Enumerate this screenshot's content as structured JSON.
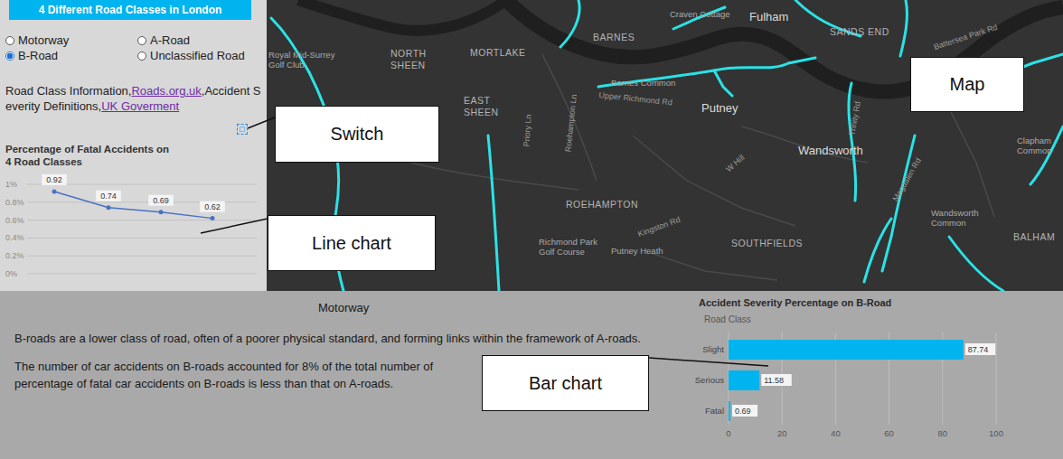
{
  "panel": {
    "title": "4 Different Road Classes in London",
    "road_classes": [
      {
        "label": "Motorway",
        "selected": false
      },
      {
        "label": "A-Road",
        "selected": false
      },
      {
        "label": "B-Road",
        "selected": true
      },
      {
        "label": "Unclassified Road",
        "selected": false
      }
    ],
    "sources": [
      {
        "text": "Road Class Information,",
        "kind": "text"
      },
      {
        "text": "Roads.org.uk",
        "kind": "link"
      },
      {
        "text": ",Accident Severity Definitions,",
        "kind": "text"
      },
      {
        "text": "UK Goverment",
        "kind": "link"
      }
    ],
    "line_chart": {
      "title": "Percentage of Fatal Accidents on 4 Road Classes",
      "ticks": [
        "1%",
        "0.8%",
        "0.6%",
        "0.4%",
        "0.2%",
        "0%"
      ],
      "values": [
        0.92,
        0.74,
        0.69,
        0.62
      ],
      "labels": [
        "0.92",
        "0.74",
        "0.69",
        "0.62"
      ]
    }
  },
  "description": {
    "heading": "Motorway",
    "paragraphs": [
      {
        "lines": [
          "B-roads are a lower class of road, often of a poorer physical standard, and forming links within the framework of A-roads."
        ]
      },
      {
        "lines": [
          "The number of car accidents on B-roads accounted for 8% of the total number of",
          "percentage of fatal car accidents on B-roads is less than that on A-roads."
        ]
      }
    ]
  },
  "bar_chart": {
    "title": "Accident Severity Percentage on B-Road",
    "axis_label": "Road Class",
    "ticks": [
      "0",
      "20",
      "40",
      "60",
      "80",
      "100"
    ],
    "bars": [
      {
        "label": "Slight",
        "value": 87.74,
        "reading": "87.74"
      },
      {
        "label": "Serious",
        "value": 11.58,
        "reading": "11.58"
      },
      {
        "label": "Fatal",
        "value": 0.69,
        "reading": "0.69"
      }
    ]
  },
  "map": {
    "labels": [
      {
        "text": "Craven Cottage",
        "kind": "poi"
      },
      {
        "text": "Fulham",
        "kind": "town"
      },
      {
        "text": "SANDS END",
        "kind": "area"
      },
      {
        "text": "Battersea Park Rd",
        "kind": "road"
      },
      {
        "text": "Royal Mid-Surrey Golf Club",
        "kind": "poi"
      },
      {
        "text": "NORTH SHEEN",
        "kind": "area"
      },
      {
        "text": "MORTLAKE",
        "kind": "area"
      },
      {
        "text": "BARNES",
        "kind": "area"
      },
      {
        "text": "Barnes Common",
        "kind": "poi"
      },
      {
        "text": "Upper Richmond Rd",
        "kind": "road"
      },
      {
        "text": "EAST SHEEN",
        "kind": "area"
      },
      {
        "text": "Putney",
        "kind": "town"
      },
      {
        "text": "Priory Ln",
        "kind": "road"
      },
      {
        "text": "Roehampton Ln",
        "kind": "road"
      },
      {
        "text": "Wandsworth",
        "kind": "town"
      },
      {
        "text": "W Hill",
        "kind": "road"
      },
      {
        "text": "Trinity Rd",
        "kind": "road"
      },
      {
        "text": "Clapham Common",
        "kind": "poi"
      },
      {
        "text": "ROEHAMPTON",
        "kind": "area"
      },
      {
        "text": "Richmond Park Golf Course",
        "kind": "poi"
      },
      {
        "text": "Kingston Rd",
        "kind": "road"
      },
      {
        "text": "Putney Heath",
        "kind": "poi"
      },
      {
        "text": "SOUTHFIELDS",
        "kind": "area"
      },
      {
        "text": "Magdalen Rd",
        "kind": "road"
      },
      {
        "text": "Wandsworth Common",
        "kind": "poi"
      },
      {
        "text": "BALHAM",
        "kind": "area"
      }
    ]
  },
  "annotations": [
    "Switch",
    "Line chart",
    "Map",
    "Bar chart"
  ]
}
